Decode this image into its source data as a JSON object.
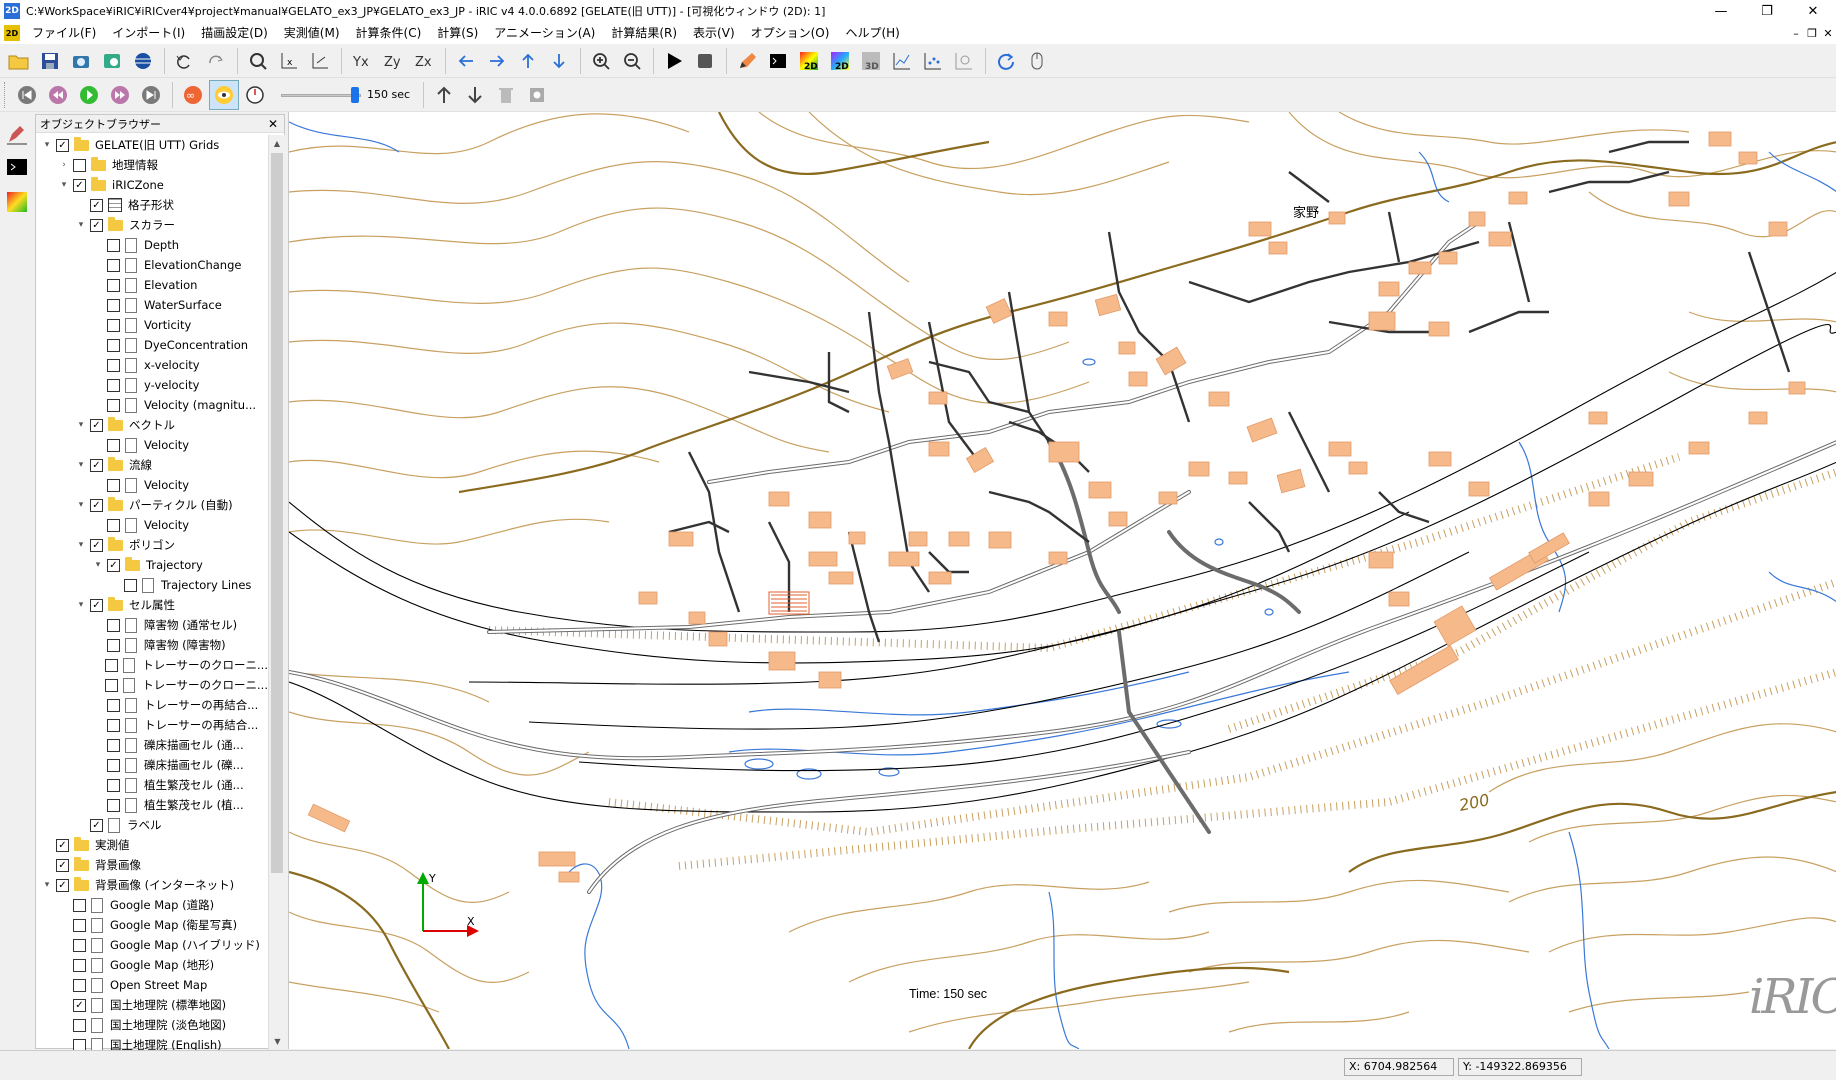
{
  "window": {
    "title": "C:¥WorkSpace¥iRIC¥iRICver4¥project¥manual¥GELATO_ex3_JP¥GELATO_ex3_JP - iRIC v4 4.0.0.6892 [GELATE(旧 UTT)] - [可視化ウィンドウ (2D): 1]",
    "app_icon": "2D",
    "minimize": "—",
    "maximize": "❐",
    "close": "✕"
  },
  "menubar": {
    "items": [
      "ファイル(F)",
      "インポート(I)",
      "描画設定(D)",
      "実測値(M)",
      "計算条件(C)",
      "計算(S)",
      "アニメーション(A)",
      "計算結果(R)",
      "表示(V)",
      "オプション(O)",
      "ヘルプ(H)"
    ],
    "mdi_min": "–",
    "mdi_restore": "❐",
    "mdi_close": "✕"
  },
  "toolbar": {
    "slider_fraction": 0.92,
    "slider_value": "150 sec"
  },
  "object_browser": {
    "title": "オブジェクトブラウザー",
    "close": "✕",
    "rows": [
      {
        "indent": 0,
        "expander": "▾",
        "checked": true,
        "icon": "folder",
        "label": "GELATE(旧 UTT) Grids"
      },
      {
        "indent": 1,
        "expander": "›",
        "checked": false,
        "icon": "folder",
        "label": "地理情報"
      },
      {
        "indent": 1,
        "expander": "▾",
        "checked": true,
        "icon": "folder",
        "label": "iRICZone"
      },
      {
        "indent": 2,
        "expander": "",
        "checked": true,
        "icon": "grid",
        "label": "格子形状"
      },
      {
        "indent": 2,
        "expander": "▾",
        "checked": true,
        "icon": "folder",
        "label": "スカラー"
      },
      {
        "indent": 3,
        "expander": "",
        "checked": false,
        "icon": "doc",
        "label": "Depth"
      },
      {
        "indent": 3,
        "expander": "",
        "checked": false,
        "icon": "doc",
        "label": "ElevationChange"
      },
      {
        "indent": 3,
        "expander": "",
        "checked": false,
        "icon": "doc",
        "label": "Elevation"
      },
      {
        "indent": 3,
        "expander": "",
        "checked": false,
        "icon": "doc",
        "label": "WaterSurface"
      },
      {
        "indent": 3,
        "expander": "",
        "checked": false,
        "icon": "doc",
        "label": "Vorticity"
      },
      {
        "indent": 3,
        "expander": "",
        "checked": false,
        "icon": "doc",
        "label": "DyeConcentration"
      },
      {
        "indent": 3,
        "expander": "",
        "checked": false,
        "icon": "doc",
        "label": "x-velocity"
      },
      {
        "indent": 3,
        "expander": "",
        "checked": false,
        "icon": "doc",
        "label": "y-velocity"
      },
      {
        "indent": 3,
        "expander": "",
        "checked": false,
        "icon": "doc",
        "label": "Velocity (magnitu..."
      },
      {
        "indent": 2,
        "expander": "▾",
        "checked": true,
        "icon": "folder",
        "label": "ベクトル"
      },
      {
        "indent": 3,
        "expander": "",
        "checked": false,
        "icon": "doc",
        "label": "Velocity"
      },
      {
        "indent": 2,
        "expander": "▾",
        "checked": true,
        "icon": "folder",
        "label": "流線"
      },
      {
        "indent": 3,
        "expander": "",
        "checked": false,
        "icon": "doc",
        "label": "Velocity"
      },
      {
        "indent": 2,
        "expander": "▾",
        "checked": true,
        "icon": "folder",
        "label": "パーティクル (自動)"
      },
      {
        "indent": 3,
        "expander": "",
        "checked": false,
        "icon": "doc",
        "label": "Velocity"
      },
      {
        "indent": 2,
        "expander": "▾",
        "checked": true,
        "icon": "folder",
        "label": "ポリゴン"
      },
      {
        "indent": 3,
        "expander": "▾",
        "checked": true,
        "icon": "folder",
        "label": "Trajectory"
      },
      {
        "indent": 4,
        "expander": "",
        "checked": false,
        "icon": "doc",
        "label": "Trajectory Lines"
      },
      {
        "indent": 2,
        "expander": "▾",
        "checked": true,
        "icon": "folder",
        "label": "セル属性"
      },
      {
        "indent": 3,
        "expander": "",
        "checked": false,
        "icon": "doc",
        "label": "障害物 (通常セル)"
      },
      {
        "indent": 3,
        "expander": "",
        "checked": false,
        "icon": "doc",
        "label": "障害物 (障害物)"
      },
      {
        "indent": 3,
        "expander": "",
        "checked": false,
        "icon": "doc",
        "label": "トレーサーのクローニ..."
      },
      {
        "indent": 3,
        "expander": "",
        "checked": false,
        "icon": "doc",
        "label": "トレーサーのクローニ..."
      },
      {
        "indent": 3,
        "expander": "",
        "checked": false,
        "icon": "doc",
        "label": "トレーサーの再結合..."
      },
      {
        "indent": 3,
        "expander": "",
        "checked": false,
        "icon": "doc",
        "label": "トレーサーの再結合..."
      },
      {
        "indent": 3,
        "expander": "",
        "checked": false,
        "icon": "doc",
        "label": "礫床描画セル (通..."
      },
      {
        "indent": 3,
        "expander": "",
        "checked": false,
        "icon": "doc",
        "label": "礫床描画セル (礫..."
      },
      {
        "indent": 3,
        "expander": "",
        "checked": false,
        "icon": "doc",
        "label": "植生繁茂セル (通..."
      },
      {
        "indent": 3,
        "expander": "",
        "checked": false,
        "icon": "doc",
        "label": "植生繁茂セル (植..."
      },
      {
        "indent": 2,
        "expander": "",
        "checked": true,
        "icon": "doc",
        "label": "ラベル"
      },
      {
        "indent": 0,
        "expander": "",
        "checked": true,
        "icon": "folder",
        "label": "実測値"
      },
      {
        "indent": 0,
        "expander": "",
        "checked": true,
        "icon": "folder",
        "label": "背景画像"
      },
      {
        "indent": 0,
        "expander": "▾",
        "checked": true,
        "icon": "folder",
        "label": "背景画像 (インターネット)"
      },
      {
        "indent": 1,
        "expander": "",
        "checked": false,
        "icon": "doc",
        "label": "Google Map (道路)"
      },
      {
        "indent": 1,
        "expander": "",
        "checked": false,
        "icon": "doc",
        "label": "Google Map (衛星写真)"
      },
      {
        "indent": 1,
        "expander": "",
        "checked": false,
        "icon": "doc",
        "label": "Google Map (ハイブリッド)"
      },
      {
        "indent": 1,
        "expander": "",
        "checked": false,
        "icon": "doc",
        "label": "Google Map (地形)"
      },
      {
        "indent": 1,
        "expander": "",
        "checked": false,
        "icon": "doc",
        "label": "Open Street Map"
      },
      {
        "indent": 1,
        "expander": "",
        "checked": true,
        "icon": "doc",
        "label": "国土地理院 (標準地図)"
      },
      {
        "indent": 1,
        "expander": "",
        "checked": false,
        "icon": "doc",
        "label": "国土地理院 (淡色地図)"
      },
      {
        "indent": 1,
        "expander": "",
        "checked": false,
        "icon": "doc",
        "label": "国土地理院 (English)"
      }
    ]
  },
  "map": {
    "time_label": "Time: 150 sec",
    "axis_y": "Y",
    "axis_x": "X",
    "place_label": "家野",
    "contour_label": "200",
    "logo": "iRIC",
    "colors": {
      "contour": "#c8a060",
      "contour_index": "#8a6a1e",
      "water": "#3a78d8",
      "building": "#f5b98a",
      "road": "#6c6c6c",
      "grid": "#000000"
    }
  },
  "statusbar": {
    "x_coord": "X: 6704.982564",
    "y_coord": "Y: -149322.869356"
  }
}
